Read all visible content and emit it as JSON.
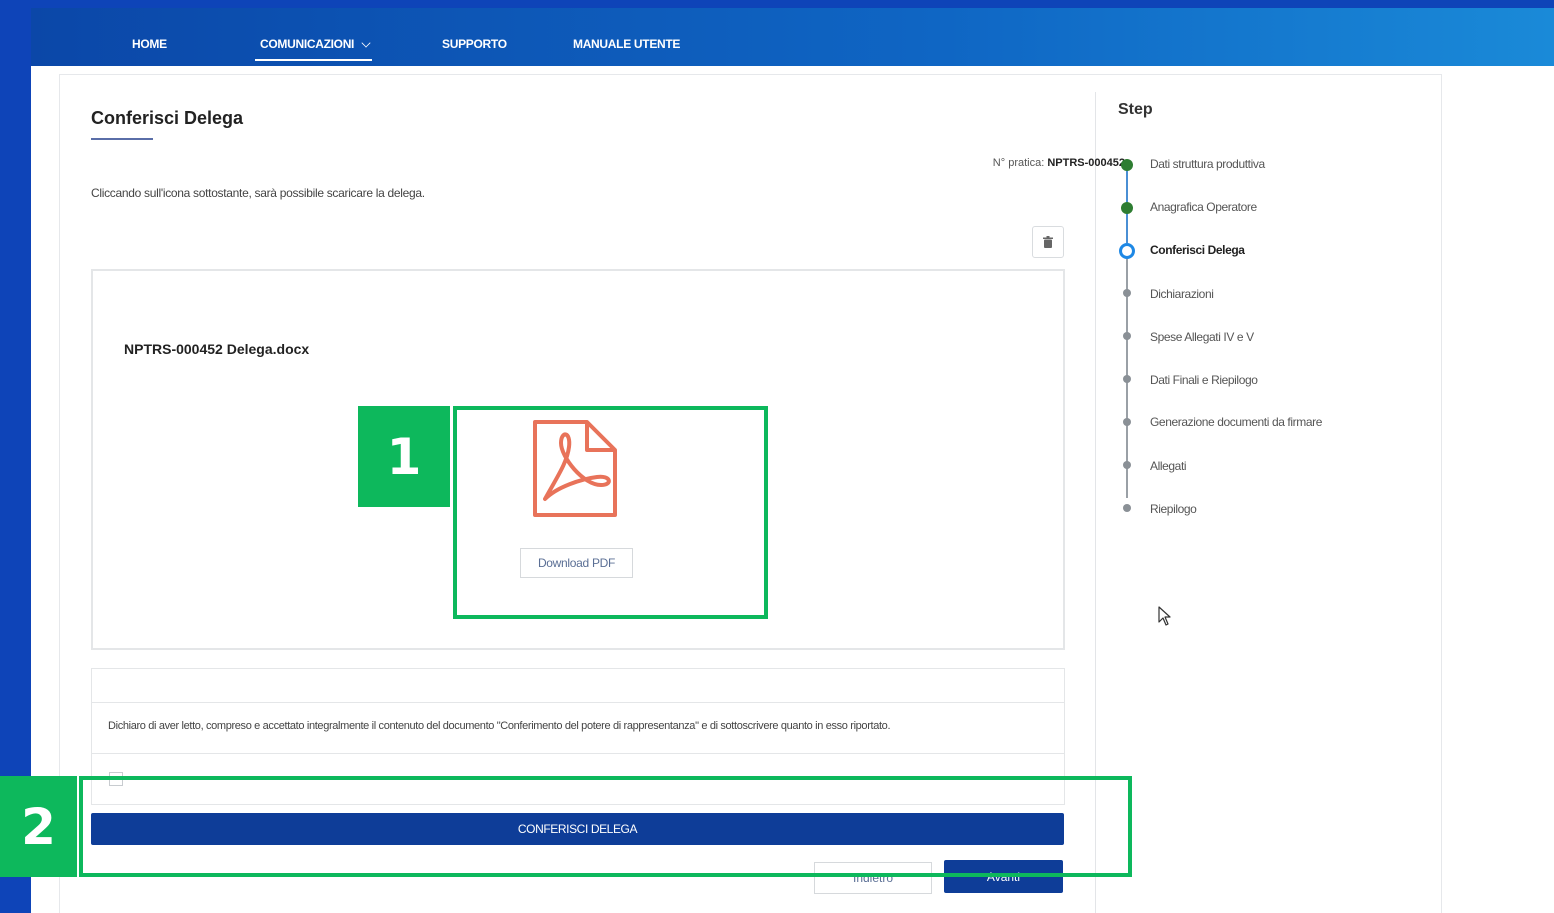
{
  "nav": {
    "items": [
      {
        "label": "HOME"
      },
      {
        "label": "COMUNICAZIONI"
      },
      {
        "label": "SUPPORTO"
      },
      {
        "label": "MANUALE UTENTE"
      }
    ]
  },
  "page": {
    "title": "Conferisci Delega",
    "pratica_label": "N° pratica:",
    "pratica_value": "NPTRS-000452",
    "intro": "Cliccando sull'icona sottostante, sarà possibile scaricare la delega."
  },
  "document": {
    "filename": "NPTRS-000452 Delega.docx",
    "download_label": "Download PDF",
    "pdf_icon": "pdf-file-icon"
  },
  "declaration": {
    "text": "Dichiaro di aver letto, compreso e accettato integralmente il contenuto del documento \"Conferimento del potere di rappresentanza\" e di sottoscrivere quanto in esso riportato.",
    "checked": false
  },
  "actions": {
    "confer_label": "CONFERISCI DELEGA",
    "back_label": "Indietro",
    "next_label": "Avanti"
  },
  "stepper": {
    "title": "Step",
    "steps": [
      {
        "label": "Dati struttura produttiva",
        "status": "done"
      },
      {
        "label": "Anagrafica Operatore",
        "status": "done"
      },
      {
        "label": "Conferisci Delega",
        "status": "current"
      },
      {
        "label": "Dichiarazioni",
        "status": "pending"
      },
      {
        "label": "Spese Allegati IV e V",
        "status": "pending"
      },
      {
        "label": "Dati Finali e Riepilogo",
        "status": "pending"
      },
      {
        "label": "Generazione documenti da firmare",
        "status": "pending"
      },
      {
        "label": "Allegati",
        "status": "pending"
      },
      {
        "label": "Riepilogo",
        "status": "pending"
      }
    ]
  },
  "callouts": {
    "one": "1",
    "two": "2"
  },
  "colors": {
    "brand_blue": "#0e3d98",
    "callout_green": "#0db85c",
    "done_green": "#2e7d32",
    "current_blue": "#1e88e5",
    "pdf_red": "#e8735a"
  }
}
